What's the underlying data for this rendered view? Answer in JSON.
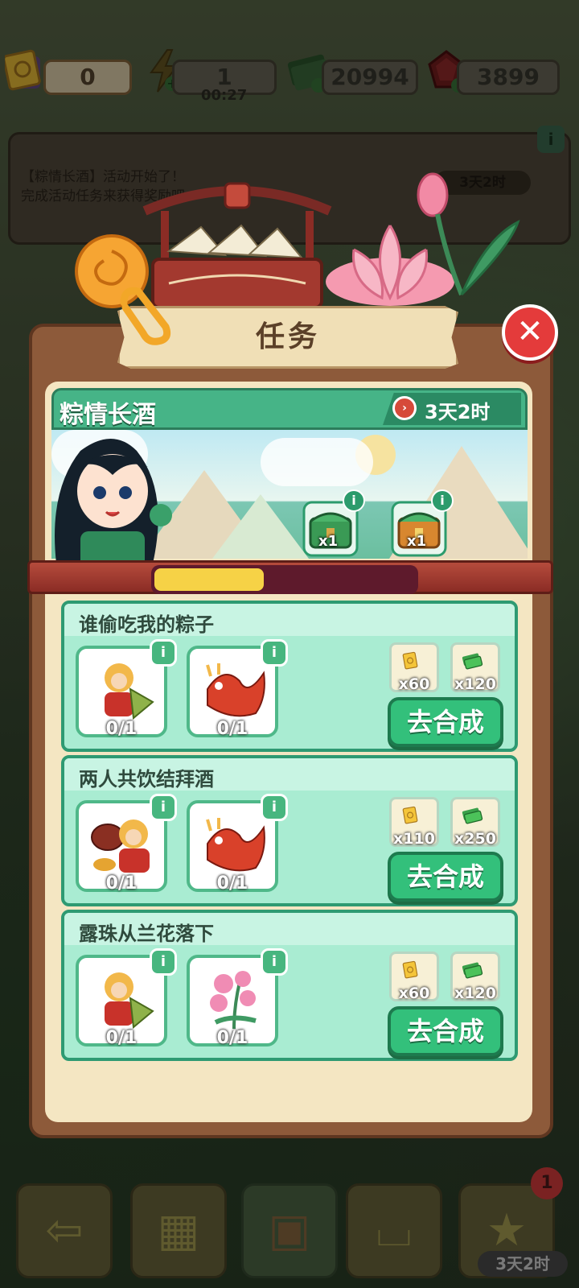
{
  "currencies": {
    "tickets": "0",
    "energy": "1",
    "energy_timer": "00:27",
    "cash": "20994",
    "gems": "3899"
  },
  "notice": {
    "line1": "【粽情长酒】活动开始了！",
    "line2": "完成活动任务来获得奖励吧",
    "timer": "3天2时",
    "info": "i"
  },
  "panel": {
    "title": "任务",
    "close": "✕"
  },
  "event": {
    "name": "粽情长酒",
    "timer": "3天2时",
    "progress": 0.42,
    "rewards": [
      {
        "type": "green-chest",
        "count": "x1",
        "info": "i"
      },
      {
        "type": "gold-chest",
        "count": "x1",
        "info": "i"
      }
    ]
  },
  "tasks": [
    {
      "title": "谁偷吃我的粽子",
      "items": [
        {
          "name": "monkey-king-zongzi",
          "count": "0/1",
          "info": "i"
        },
        {
          "name": "red-dragon",
          "count": "0/1",
          "info": "i"
        }
      ],
      "rewards": [
        {
          "icon": "ticket-icon",
          "count": "x60"
        },
        {
          "icon": "cash-icon",
          "count": "x120"
        }
      ],
      "button": "去合成"
    },
    {
      "title": "两人共饮结拜酒",
      "items": [
        {
          "name": "monkey-king-wine",
          "count": "0/1",
          "info": "i"
        },
        {
          "name": "red-dragon",
          "count": "0/1",
          "info": "i"
        }
      ],
      "rewards": [
        {
          "icon": "ticket-icon",
          "count": "x110"
        },
        {
          "icon": "cash-icon",
          "count": "x250"
        }
      ],
      "button": "去合成"
    },
    {
      "title": "露珠从兰花落下",
      "items": [
        {
          "name": "monkey-king-zongzi",
          "count": "0/1",
          "info": "i"
        },
        {
          "name": "pink-orchid",
          "count": "0/1",
          "info": "i"
        }
      ],
      "rewards": [
        {
          "icon": "ticket-icon",
          "count": "x60"
        },
        {
          "icon": "cash-icon",
          "count": "x120"
        }
      ],
      "button": "去合成"
    }
  ],
  "bottom_nav": {
    "badge": "1",
    "timer": "3天2时"
  },
  "colors": {
    "accent_green": "#33c07b",
    "card_green": "#a9ecd2",
    "progress_yellow": "#f6d246",
    "close_red": "#e43b3b"
  }
}
